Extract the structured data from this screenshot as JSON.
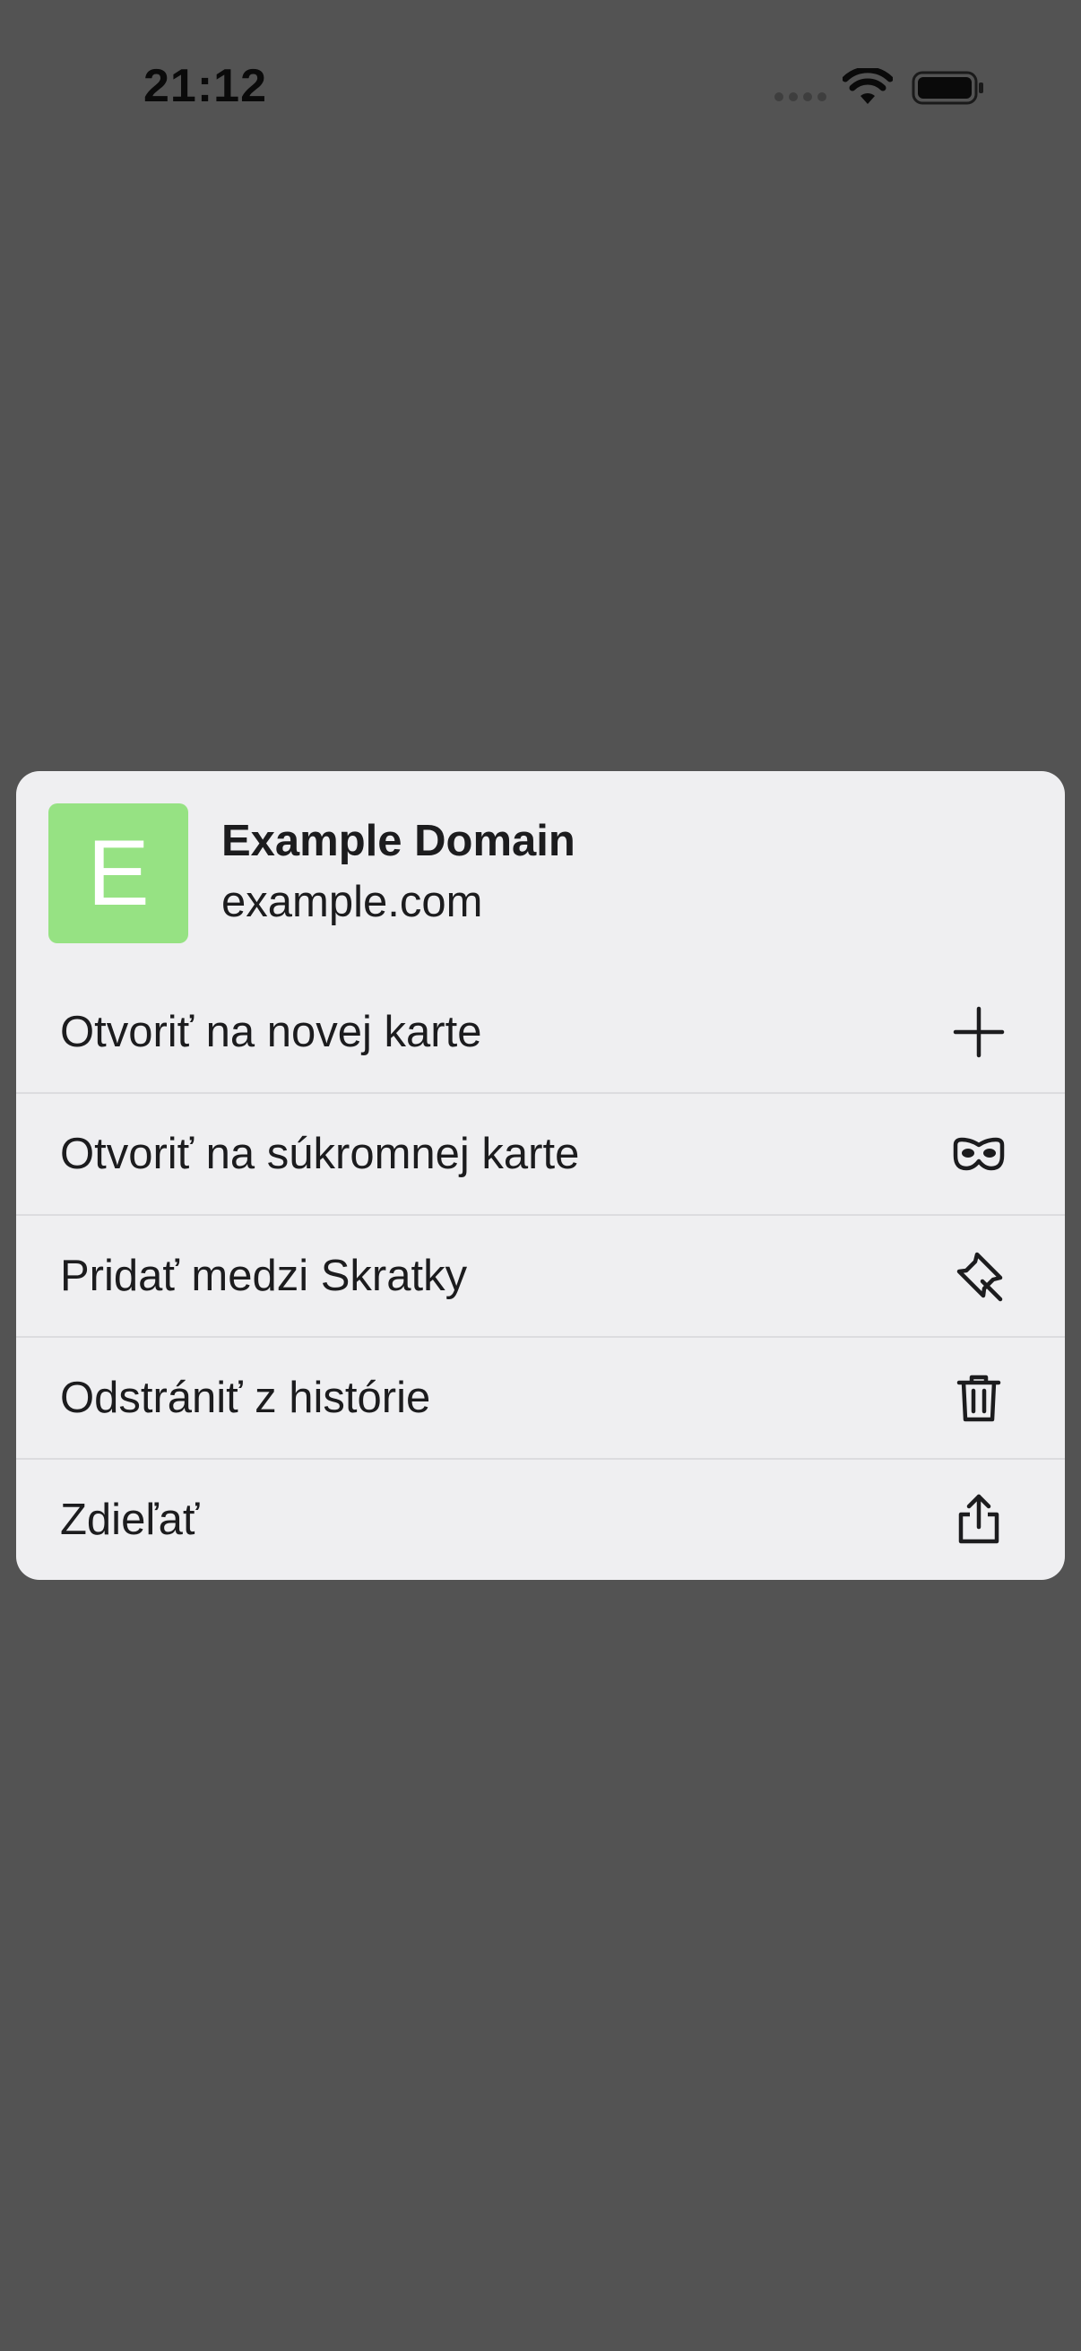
{
  "status_bar": {
    "time": "21:12"
  },
  "context_menu": {
    "header": {
      "favicon_letter": "E",
      "favicon_color": "#96e283",
      "title": "Example Domain",
      "url": "example.com"
    },
    "items": [
      {
        "label": "Otvoriť na novej karte",
        "icon": "plus-icon"
      },
      {
        "label": "Otvoriť na súkromnej karte",
        "icon": "private-mask-icon"
      },
      {
        "label": "Pridať medzi Skratky",
        "icon": "pin-icon"
      },
      {
        "label": "Odstrániť z histórie",
        "icon": "trash-icon"
      },
      {
        "label": "Zdieľať",
        "icon": "share-icon"
      }
    ]
  }
}
